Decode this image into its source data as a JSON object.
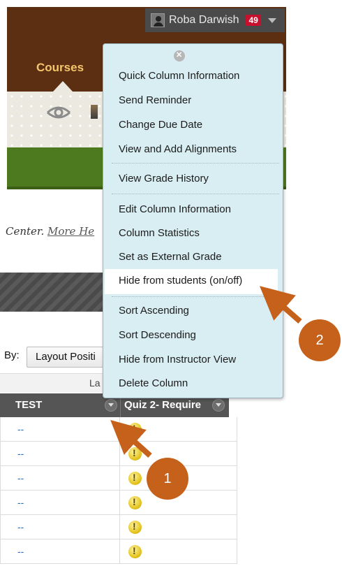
{
  "header": {
    "user_name": "Roba Darwish",
    "notification_count": "49",
    "courses_tab": "Courses"
  },
  "page": {
    "help_text_prefix": "Center.",
    "help_link": "More He",
    "sort_by_label": "By:",
    "sort_by_value": "Layout Positi",
    "column_group_label": "La"
  },
  "table": {
    "headers": [
      "TEST",
      "Quiz 2- Require"
    ],
    "rows": [
      {
        "test": "--"
      },
      {
        "test": "--"
      },
      {
        "test": "--"
      },
      {
        "test": "--"
      },
      {
        "test": "--"
      },
      {
        "test": "--"
      }
    ]
  },
  "context_menu": {
    "items": [
      "Quick Column Information",
      "Send Reminder",
      "Change Due Date",
      "View and Add Alignments",
      "View Grade History",
      "Edit Column Information",
      "Column Statistics",
      "Set as External Grade",
      "Hide from students (on/off)",
      "Sort Ascending",
      "Sort Descending",
      "Hide from Instructor View",
      "Delete Column"
    ],
    "highlighted_item": "Hide from students (on/off)"
  },
  "annotations": {
    "callout_1": "1",
    "callout_2": "2",
    "callout_color": "#c5611a"
  },
  "colors": {
    "header_brown": "#5c2f13",
    "course_tab_gold": "#f3c66b",
    "menu_background": "#d9eef3",
    "green_bar": "#4d7a1f"
  }
}
